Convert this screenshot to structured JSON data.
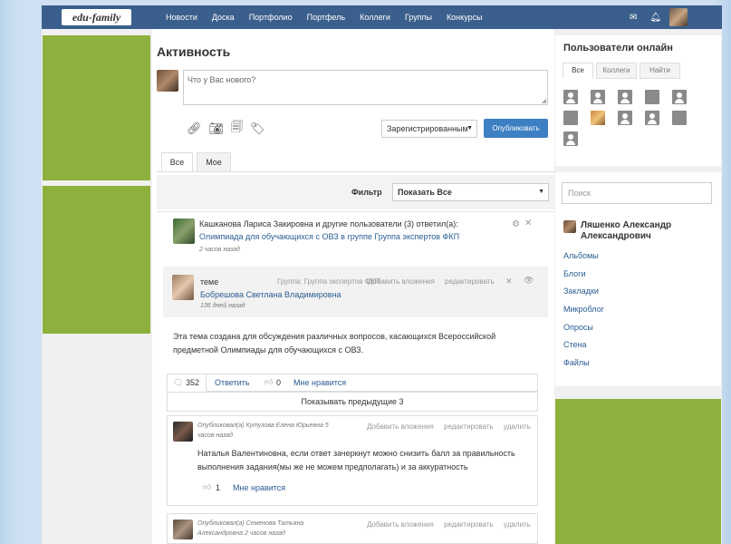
{
  "nav": {
    "logo": "edu-family",
    "links": [
      "Новости",
      "Доска",
      "Портфолио",
      "Портфель",
      "Коллеги",
      "Группы",
      "Конкурсы"
    ],
    "icons": [
      "mail-icon",
      "bell-icon",
      "user-icon"
    ]
  },
  "activity": {
    "title": "Активность",
    "composer_placeholder": "Что у Вас нового?",
    "visibility": "Зарегистрированным",
    "publish": "Опубликовать",
    "tabs": [
      "Все",
      "Мое"
    ],
    "filter_label": "Фильтр",
    "filter_value": "Показать Все"
  },
  "post": {
    "line1": "Кашканова Лариса Закировна и другие пользователи (3) ответил(а):",
    "line2": "Олимпиада для обучающихся с ОВЗ в группе Группа экспертов ФКП",
    "time": "2 часов назад",
    "quote_theme": "теме",
    "quote_group": "Группа: Группа экспертов ФКП",
    "quote_add": "Добавить вложения",
    "quote_edit": "редактировать",
    "quote_author": "Бобрешова Светлана Владимировна",
    "quote_time": "136 дней назад",
    "body1": "Эта тема создана для обсуждения различных вопросов, касающихся Всероссийской",
    "body2": "предметной Олимпиады для обучающихся с ОВЗ.",
    "comments_count": "352",
    "reply": "Ответить",
    "likes": "0",
    "like": "Мне нравится",
    "show_prev": "Показывать предыдущие 3"
  },
  "comments": [
    {
      "meta1": "Опубликовал(а) Кутузова Елена Юрьевна 5",
      "meta2": "часов назад",
      "add": "Добавить вложения",
      "edit": "редактировать",
      "del": "удалить",
      "text1": "Наталья Валентиновна, если ответ зачеркнут можно снизить балл за правильность",
      "text2": "выполнения задания(мы же не можем предполагать) и за аккуратность",
      "likes": "1",
      "like": "Мне нравится"
    },
    {
      "meta1": "Опубликовал(а) Семенова Татьяна",
      "meta2": "Александровна 2 часов назад",
      "add": "Добавить вложения",
      "edit": "редактировать",
      "del": "удалить"
    }
  ],
  "sidebar": {
    "online_title": "Пользователи онлайн",
    "tabs": [
      "Все",
      "Коллеги",
      "Найти"
    ],
    "search_placeholder": "Поиск",
    "profile_name1": "Ляшенко Александр",
    "profile_name2": "Александрович",
    "menu": [
      "Альбомы",
      "Блоги",
      "Закладки",
      "Микроблог",
      "Опросы",
      "Стена",
      "Файлы"
    ]
  },
  "colors": {
    "nav": "#3b5f8c",
    "accent_green": "#8db13c",
    "publish": "#3d7fc3",
    "link": "#2a5d92"
  }
}
